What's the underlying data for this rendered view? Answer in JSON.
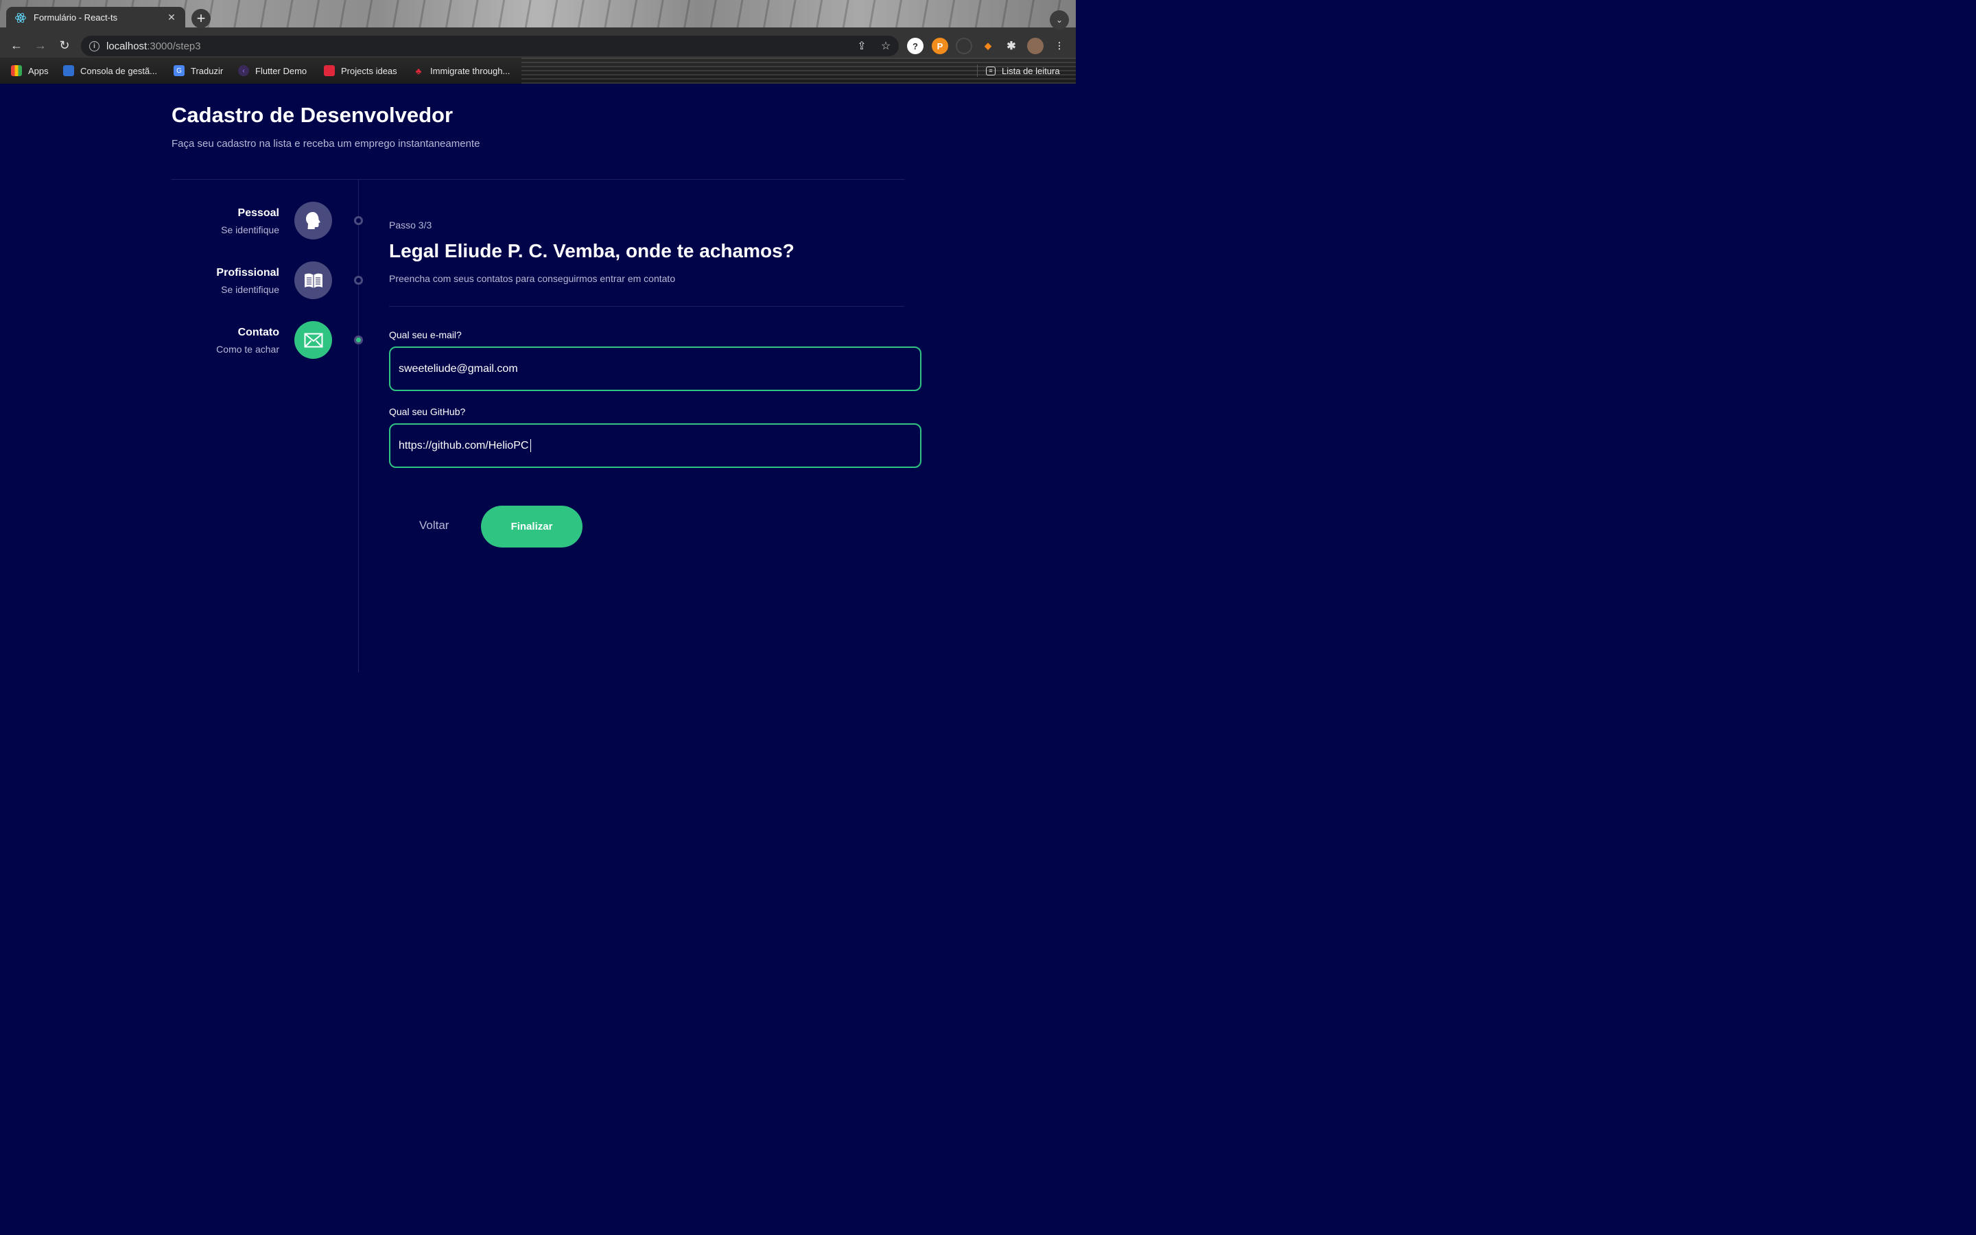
{
  "browser": {
    "tab_title": "Formulário - React-ts",
    "url_host": "localhost",
    "url_path": ":3000/step3",
    "bookmarks": [
      "Apps",
      "Consola de gestã...",
      "Traduzir",
      "Flutter Demo",
      "Projects ideas",
      "Immigrate through..."
    ],
    "reading_list": "Lista de leitura"
  },
  "header": {
    "title": "Cadastro de Desenvolvedor",
    "subtitle": "Faça seu cadastro na lista e receba um emprego instantaneamente"
  },
  "steps": [
    {
      "title": "Pessoal",
      "subtitle": "Se identifique",
      "icon": "person-icon",
      "active": false
    },
    {
      "title": "Profissional",
      "subtitle": "Se identifique",
      "icon": "book-icon",
      "active": false
    },
    {
      "title": "Contato",
      "subtitle": "Como te achar",
      "icon": "mail-icon",
      "active": true
    }
  ],
  "form": {
    "step_count": "Passo 3/3",
    "title": "Legal Eliude P. C. Vemba, onde te achamos?",
    "subtitle": "Preencha com seus contatos para conseguirmos entrar em contato",
    "email_label": "Qual seu e-mail?",
    "email_value": "sweeteliude@gmail.com",
    "github_label": "Qual seu GitHub?",
    "github_value": "https://github.com/HelioPC",
    "back_label": "Voltar",
    "finish_label": "Finalizar"
  },
  "colors": {
    "background": "#02044a",
    "accent": "#30c483",
    "step_circle": "#494a7e"
  }
}
